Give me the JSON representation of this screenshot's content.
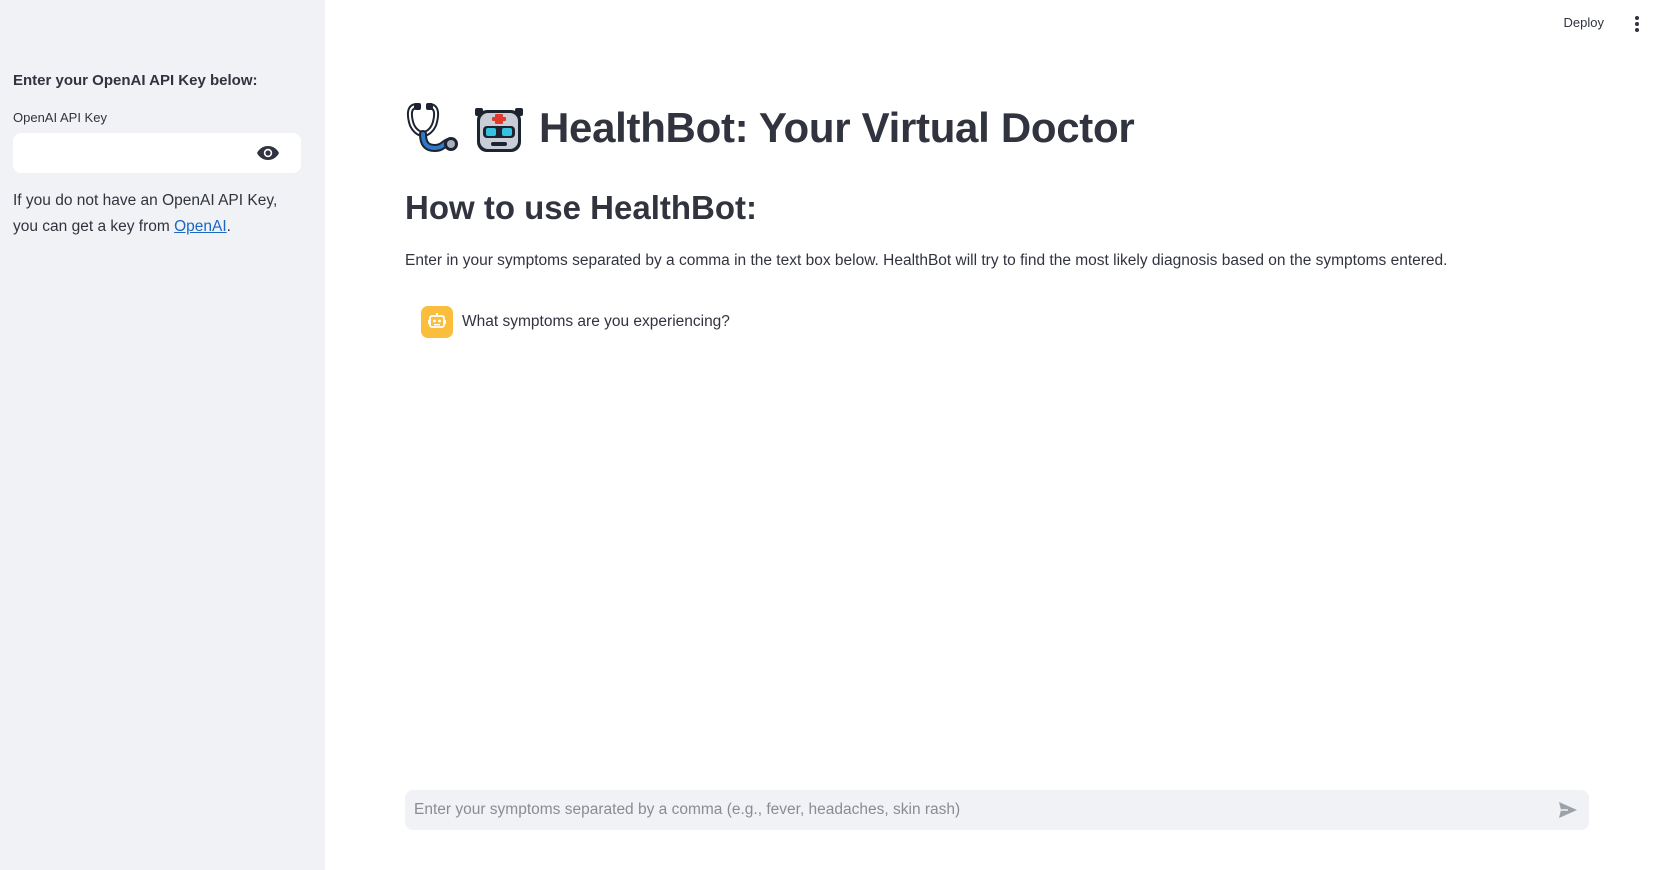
{
  "sidebar": {
    "heading": "Enter your OpenAI API Key below:",
    "api_key_label": "OpenAI API Key",
    "api_key_value": "",
    "help_text_prefix": "If you do not have an OpenAI API Key, you can get a key from ",
    "help_link_text": "OpenAI",
    "help_text_suffix": "."
  },
  "header": {
    "deploy_label": "Deploy"
  },
  "main": {
    "title": "HealthBot: Your Virtual Doctor",
    "title_icons": [
      "stethoscope-icon",
      "robot-icon"
    ],
    "subtitle": "How to use HealthBot:",
    "instructions": "Enter in your symptoms separated by a comma in the text box below. HealthBot will try to find the most likely diagnosis based on the symptoms entered.",
    "messages": [
      {
        "role": "assistant",
        "avatar": "bot-avatar-icon",
        "text": "What symptoms are you experiencing?"
      }
    ]
  },
  "chat_input": {
    "placeholder": "Enter your symptoms separated by a comma (e.g., fever, headaches, skin rash)",
    "value": ""
  },
  "colors": {
    "sidebar_bg": "#f0f2f6",
    "text": "#31333f",
    "link": "#1c66c4",
    "avatar": "#fbbd3c",
    "input_bg": "#f0f2f6"
  }
}
